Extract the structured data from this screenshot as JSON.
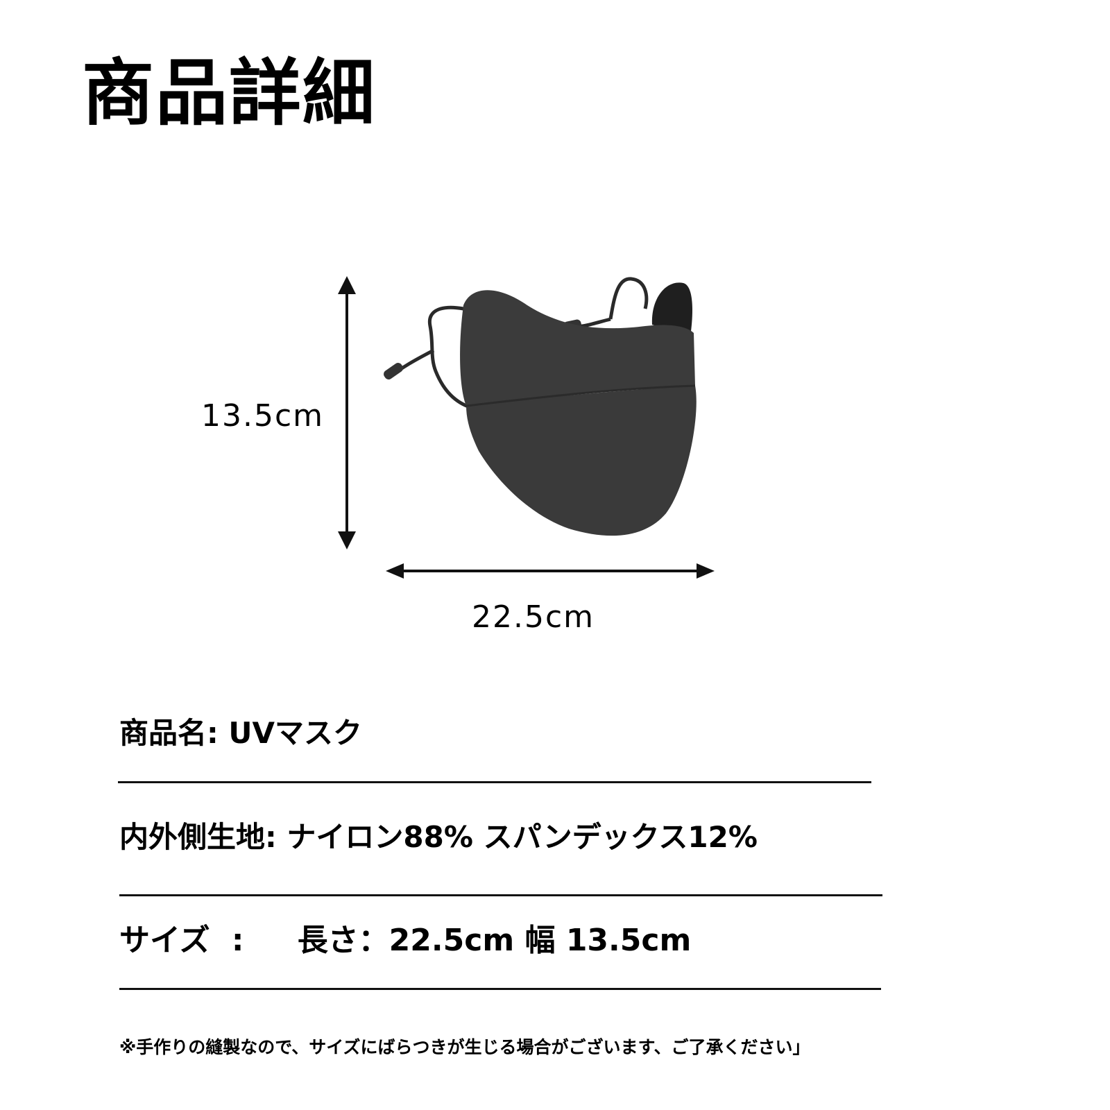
{
  "page": {
    "title": "商品詳細"
  },
  "dimensions": {
    "height_label": "13.5cm",
    "width_label": "22.5cm"
  },
  "specs": {
    "name_label": "商品名:",
    "name_value": "UVマスク",
    "fabric_label": "内外側生地:",
    "fabric_value": "ナイロン88% スパンデックス12%",
    "size_label": "サイズ",
    "size_separator": ":",
    "size_value": "長さ：22.5cm 幅 13.5cm"
  },
  "note": "※手作りの縫製なので、サイズにばらつきが生じる場合がございます、ご了承ください」",
  "colors": {
    "mask": "#3a3a3a",
    "mask_inner": "#1f1f1f",
    "arrow": "#111111"
  },
  "icons": {
    "product": "face-mask-illustration",
    "height_arrow": "vertical-double-arrow",
    "width_arrow": "horizontal-double-arrow"
  }
}
